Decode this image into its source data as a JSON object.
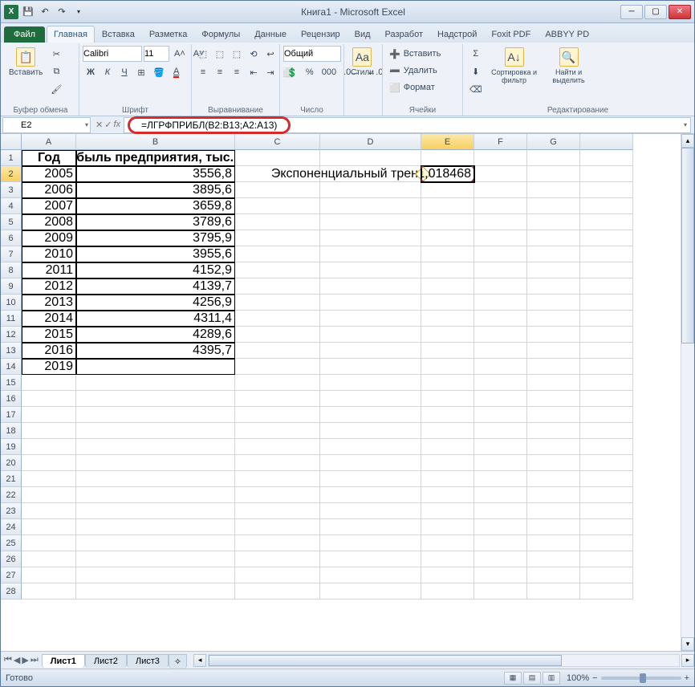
{
  "window": {
    "title": "Книга1 - Microsoft Excel"
  },
  "tabs": {
    "file": "Файл",
    "items": [
      "Главная",
      "Вставка",
      "Разметка",
      "Формулы",
      "Данные",
      "Рецензир",
      "Вид",
      "Разработ",
      "Надстрой",
      "Foxit PDF",
      "ABBYY PD"
    ],
    "active": 0
  },
  "ribbon": {
    "clipboard": {
      "paste": "Вставить",
      "label": "Буфер обмена"
    },
    "font": {
      "name": "Calibri",
      "size": "11",
      "label": "Шрифт",
      "bold": "Ж",
      "italic": "К",
      "underline": "Ч"
    },
    "alignment": {
      "label": "Выравнивание"
    },
    "number": {
      "format": "Общий",
      "label": "Число"
    },
    "styles": {
      "btn": "Стили",
      "label": ""
    },
    "cells": {
      "insert": "Вставить",
      "delete": "Удалить",
      "format": "Формат",
      "label": "Ячейки"
    },
    "editing": {
      "sort": "Сортировка и фильтр",
      "find": "Найти и выделить",
      "label": "Редактирование",
      "sum": "Σ"
    }
  },
  "namebox": "E2",
  "formula": "=ЛГРФПРИБЛ(B2:B13;A2:A13)",
  "fx": "fx",
  "columns": [
    "A",
    "B",
    "C",
    "D",
    "E",
    "F",
    "G"
  ],
  "headers": {
    "A": "Год",
    "B": "Прибыль предприятия, тыс. руб"
  },
  "data_rows": [
    {
      "r": 2,
      "A": "2005",
      "B": "3556,8"
    },
    {
      "r": 3,
      "A": "2006",
      "B": "3895,6"
    },
    {
      "r": 4,
      "A": "2007",
      "B": "3659,8"
    },
    {
      "r": 5,
      "A": "2008",
      "B": "3789,6"
    },
    {
      "r": 6,
      "A": "2009",
      "B": "3795,9"
    },
    {
      "r": 7,
      "A": "2010",
      "B": "3955,6"
    },
    {
      "r": 8,
      "A": "2011",
      "B": "4152,9"
    },
    {
      "r": 9,
      "A": "2012",
      "B": "4139,7"
    },
    {
      "r": 10,
      "A": "2013",
      "B": "4256,9"
    },
    {
      "r": 11,
      "A": "2014",
      "B": "4311,4"
    },
    {
      "r": 12,
      "A": "2015",
      "B": "4289,6"
    },
    {
      "r": 13,
      "A": "2016",
      "B": "4395,7"
    }
  ],
  "extra_row": {
    "r": 14,
    "A": "2019"
  },
  "trend_label": "Экспоненциальный трен",
  "result_value": "1,018468",
  "sheets": {
    "items": [
      "Лист1",
      "Лист2",
      "Лист3"
    ],
    "active": 0
  },
  "status": {
    "ready": "Готово",
    "zoom": "100%"
  }
}
